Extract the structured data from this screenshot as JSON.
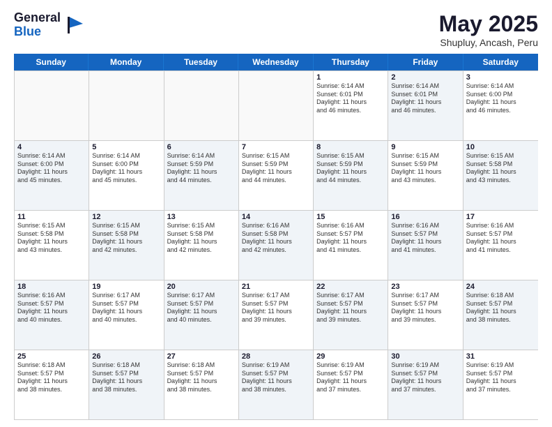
{
  "logo": {
    "general": "General",
    "blue": "Blue"
  },
  "title": "May 2025",
  "location": "Shupluy, Ancash, Peru",
  "header_days": [
    "Sunday",
    "Monday",
    "Tuesday",
    "Wednesday",
    "Thursday",
    "Friday",
    "Saturday"
  ],
  "rows": [
    [
      {
        "day": "",
        "text": "",
        "empty": true
      },
      {
        "day": "",
        "text": "",
        "empty": true
      },
      {
        "day": "",
        "text": "",
        "empty": true
      },
      {
        "day": "",
        "text": "",
        "empty": true
      },
      {
        "day": "1",
        "text": "Sunrise: 6:14 AM\nSunset: 6:01 PM\nDaylight: 11 hours\nand 46 minutes.",
        "empty": false
      },
      {
        "day": "2",
        "text": "Sunrise: 6:14 AM\nSunset: 6:01 PM\nDaylight: 11 hours\nand 46 minutes.",
        "empty": false,
        "alt": true
      },
      {
        "day": "3",
        "text": "Sunrise: 6:14 AM\nSunset: 6:00 PM\nDaylight: 11 hours\nand 46 minutes.",
        "empty": false
      }
    ],
    [
      {
        "day": "4",
        "text": "Sunrise: 6:14 AM\nSunset: 6:00 PM\nDaylight: 11 hours\nand 45 minutes.",
        "empty": false,
        "alt": true
      },
      {
        "day": "5",
        "text": "Sunrise: 6:14 AM\nSunset: 6:00 PM\nDaylight: 11 hours\nand 45 minutes.",
        "empty": false
      },
      {
        "day": "6",
        "text": "Sunrise: 6:14 AM\nSunset: 5:59 PM\nDaylight: 11 hours\nand 44 minutes.",
        "empty": false,
        "alt": true
      },
      {
        "day": "7",
        "text": "Sunrise: 6:15 AM\nSunset: 5:59 PM\nDaylight: 11 hours\nand 44 minutes.",
        "empty": false
      },
      {
        "day": "8",
        "text": "Sunrise: 6:15 AM\nSunset: 5:59 PM\nDaylight: 11 hours\nand 44 minutes.",
        "empty": false,
        "alt": true
      },
      {
        "day": "9",
        "text": "Sunrise: 6:15 AM\nSunset: 5:59 PM\nDaylight: 11 hours\nand 43 minutes.",
        "empty": false
      },
      {
        "day": "10",
        "text": "Sunrise: 6:15 AM\nSunset: 5:58 PM\nDaylight: 11 hours\nand 43 minutes.",
        "empty": false,
        "alt": true
      }
    ],
    [
      {
        "day": "11",
        "text": "Sunrise: 6:15 AM\nSunset: 5:58 PM\nDaylight: 11 hours\nand 43 minutes.",
        "empty": false
      },
      {
        "day": "12",
        "text": "Sunrise: 6:15 AM\nSunset: 5:58 PM\nDaylight: 11 hours\nand 42 minutes.",
        "empty": false,
        "alt": true
      },
      {
        "day": "13",
        "text": "Sunrise: 6:15 AM\nSunset: 5:58 PM\nDaylight: 11 hours\nand 42 minutes.",
        "empty": false
      },
      {
        "day": "14",
        "text": "Sunrise: 6:16 AM\nSunset: 5:58 PM\nDaylight: 11 hours\nand 42 minutes.",
        "empty": false,
        "alt": true
      },
      {
        "day": "15",
        "text": "Sunrise: 6:16 AM\nSunset: 5:57 PM\nDaylight: 11 hours\nand 41 minutes.",
        "empty": false
      },
      {
        "day": "16",
        "text": "Sunrise: 6:16 AM\nSunset: 5:57 PM\nDaylight: 11 hours\nand 41 minutes.",
        "empty": false,
        "alt": true
      },
      {
        "day": "17",
        "text": "Sunrise: 6:16 AM\nSunset: 5:57 PM\nDaylight: 11 hours\nand 41 minutes.",
        "empty": false
      }
    ],
    [
      {
        "day": "18",
        "text": "Sunrise: 6:16 AM\nSunset: 5:57 PM\nDaylight: 11 hours\nand 40 minutes.",
        "empty": false,
        "alt": true
      },
      {
        "day": "19",
        "text": "Sunrise: 6:17 AM\nSunset: 5:57 PM\nDaylight: 11 hours\nand 40 minutes.",
        "empty": false
      },
      {
        "day": "20",
        "text": "Sunrise: 6:17 AM\nSunset: 5:57 PM\nDaylight: 11 hours\nand 40 minutes.",
        "empty": false,
        "alt": true
      },
      {
        "day": "21",
        "text": "Sunrise: 6:17 AM\nSunset: 5:57 PM\nDaylight: 11 hours\nand 39 minutes.",
        "empty": false
      },
      {
        "day": "22",
        "text": "Sunrise: 6:17 AM\nSunset: 5:57 PM\nDaylight: 11 hours\nand 39 minutes.",
        "empty": false,
        "alt": true
      },
      {
        "day": "23",
        "text": "Sunrise: 6:17 AM\nSunset: 5:57 PM\nDaylight: 11 hours\nand 39 minutes.",
        "empty": false
      },
      {
        "day": "24",
        "text": "Sunrise: 6:18 AM\nSunset: 5:57 PM\nDaylight: 11 hours\nand 38 minutes.",
        "empty": false,
        "alt": true
      }
    ],
    [
      {
        "day": "25",
        "text": "Sunrise: 6:18 AM\nSunset: 5:57 PM\nDaylight: 11 hours\nand 38 minutes.",
        "empty": false
      },
      {
        "day": "26",
        "text": "Sunrise: 6:18 AM\nSunset: 5:57 PM\nDaylight: 11 hours\nand 38 minutes.",
        "empty": false,
        "alt": true
      },
      {
        "day": "27",
        "text": "Sunrise: 6:18 AM\nSunset: 5:57 PM\nDaylight: 11 hours\nand 38 minutes.",
        "empty": false
      },
      {
        "day": "28",
        "text": "Sunrise: 6:19 AM\nSunset: 5:57 PM\nDaylight: 11 hours\nand 38 minutes.",
        "empty": false,
        "alt": true
      },
      {
        "day": "29",
        "text": "Sunrise: 6:19 AM\nSunset: 5:57 PM\nDaylight: 11 hours\nand 37 minutes.",
        "empty": false
      },
      {
        "day": "30",
        "text": "Sunrise: 6:19 AM\nSunset: 5:57 PM\nDaylight: 11 hours\nand 37 minutes.",
        "empty": false,
        "alt": true
      },
      {
        "day": "31",
        "text": "Sunrise: 6:19 AM\nSunset: 5:57 PM\nDaylight: 11 hours\nand 37 minutes.",
        "empty": false
      }
    ]
  ]
}
